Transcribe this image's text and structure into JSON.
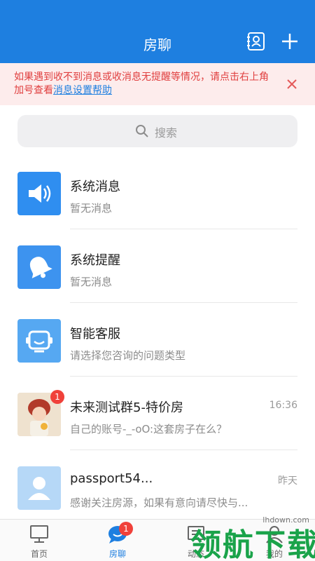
{
  "header": {
    "title": "房聊",
    "contacts_icon": "contacts-card-icon",
    "add_icon": "plus-icon"
  },
  "notice": {
    "text": "如果遇到收不到消息或收消息无提醒等情况，请点击右上角加号查看",
    "link": "消息设置帮助",
    "close_icon": "close-icon",
    "color": "#e03e3e"
  },
  "search": {
    "placeholder": "搜索"
  },
  "conversations": [
    {
      "name": "系统消息",
      "preview": "暂无消息",
      "time": "",
      "icon": "speaker-icon"
    },
    {
      "name": "系统提醒",
      "preview": "暂无消息",
      "time": "",
      "icon": "bell-icon"
    },
    {
      "name": "智能客服",
      "preview": "请选择您咨询的问题类型",
      "time": "",
      "icon": "customer-service-icon"
    },
    {
      "name": "未来测试群5-特价房",
      "preview": "自己的账号-_-oO:这套房子在么？",
      "time": "16:36",
      "icon": "group-avatar",
      "badge": "1"
    },
    {
      "name": "passport54...",
      "preview": "感谢关注房源，如果有意向请尽快与...",
      "time": "昨天",
      "icon": "user-avatar-icon"
    }
  ],
  "tabs": [
    {
      "label": "首页",
      "icon": "monitor-icon"
    },
    {
      "label": "房聊",
      "icon": "chat-bubble-icon",
      "badge": "1"
    },
    {
      "label": "动态",
      "icon": "news-icon"
    },
    {
      "label": "我的",
      "icon": "profile-icon"
    }
  ],
  "watermark": {
    "text": "领航下载",
    "url": "lhdown.com"
  },
  "colors": {
    "brand": "#1e7fe0",
    "badge": "#f0413a"
  }
}
